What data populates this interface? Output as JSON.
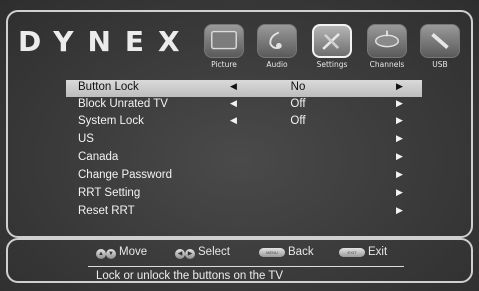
{
  "brand": {
    "logo_text": "DYNEX"
  },
  "tabs": [
    {
      "label": "Picture",
      "icon": "picture-icon",
      "active": false
    },
    {
      "label": "Audio",
      "icon": "audio-icon",
      "active": false
    },
    {
      "label": "Settings",
      "icon": "settings-icon",
      "active": true
    },
    {
      "label": "Channels",
      "icon": "channels-icon",
      "active": false
    },
    {
      "label": "USB",
      "icon": "usb-icon",
      "active": false
    }
  ],
  "menu": {
    "rows": [
      {
        "label": "Button Lock",
        "value": "No",
        "left_arrow": "◀",
        "right_arrow": "▶",
        "selected": true
      },
      {
        "label": "Block Unrated TV",
        "value": "Off",
        "left_arrow": "◀",
        "right_arrow": "▶",
        "selected": false
      },
      {
        "label": "System Lock",
        "value": "Off",
        "left_arrow": "◀",
        "right_arrow": "▶",
        "selected": false
      },
      {
        "label": "US",
        "value": "",
        "left_arrow": "",
        "right_arrow": "▶",
        "selected": false
      },
      {
        "label": "Canada",
        "value": "",
        "left_arrow": "",
        "right_arrow": "▶",
        "selected": false
      },
      {
        "label": "Change Password",
        "value": "",
        "left_arrow": "",
        "right_arrow": "▶",
        "selected": false
      },
      {
        "label": "RRT Setting",
        "value": "",
        "left_arrow": "",
        "right_arrow": "▶",
        "selected": false
      },
      {
        "label": "Reset RRT",
        "value": "",
        "left_arrow": "",
        "right_arrow": "▶",
        "selected": false
      }
    ]
  },
  "hints": {
    "move": "Move",
    "select": "Select",
    "back": "Back",
    "exit": "Exit",
    "menu_key": "MENU",
    "exit_key": "EXIT"
  },
  "help_text": "Lock or unlock the buttons on the TV",
  "colors": {
    "background": "#3a3a3a",
    "border": "#d0d0d0",
    "highlight": "#cfcfcf"
  }
}
